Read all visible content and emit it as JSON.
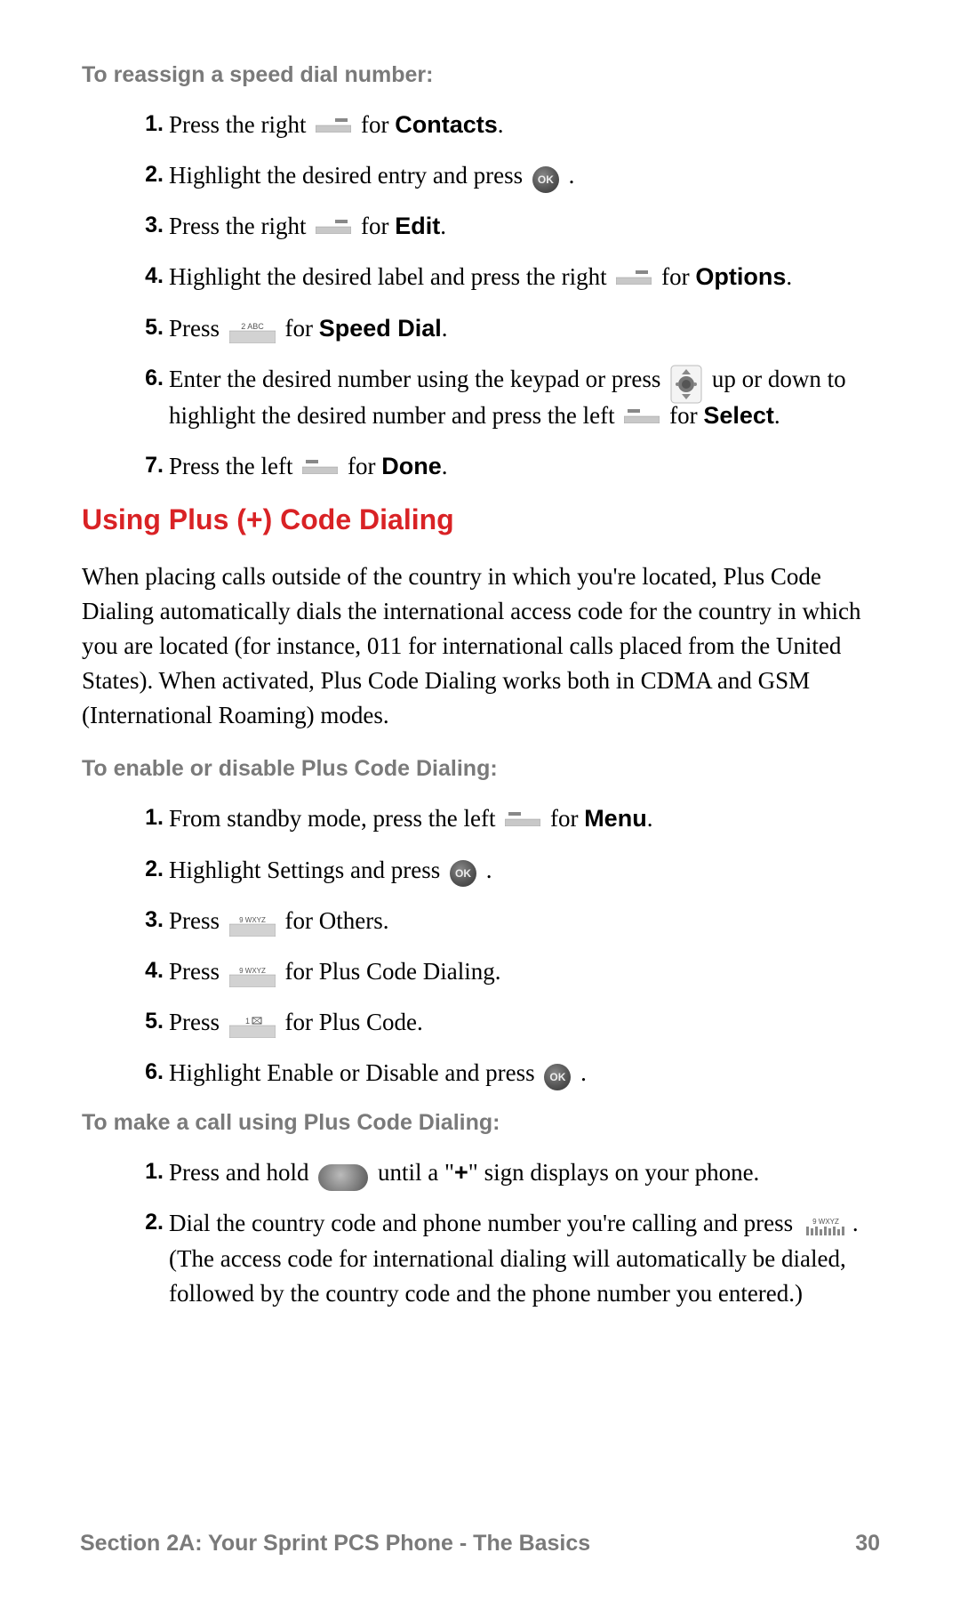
{
  "headings": {
    "reassign": "To reassign a speed dial number:",
    "section": "Using Plus (+) Code Dialing",
    "enable": "To enable or disable Plus Code Dialing:",
    "make_call": "To make a call using Plus Code Dialing:"
  },
  "steps_reassign": {
    "n1": "1.",
    "s1a": "Press the right ",
    "s1b": " for ",
    "s1c": "Contacts",
    "s1d": ".",
    "n2": "2.",
    "s2a": "Highlight the desired entry and press ",
    "s2b": ".",
    "n3": "3.",
    "s3a": " Press the right ",
    "s3b": " for ",
    "s3c": "Edit",
    "s3d": ".",
    "n4": "4.",
    "s4a": "Highlight the desired label and press the right ",
    "s4b": " for ",
    "s4c": "Options",
    "s4d": ".",
    "n5": "5.",
    "s5a": "Press ",
    "s5b": " for ",
    "s5c": "Speed Dial",
    "s5d": ".",
    "n6": "6.",
    "s6a": "Enter the desired number using the keypad or press ",
    "s6b": " up or down to highlight the desired number and press the left ",
    "s6c": " for ",
    "s6d": "Select",
    "s6e": ".",
    "n7": "7.",
    "s7a": "Press the left ",
    "s7b": " for ",
    "s7c": "Done",
    "s7d": "."
  },
  "para_plus": "When placing calls outside of the country in which you're located, Plus Code Dialing automatically dials the international access code for the country in which you are located (for instance, 011 for international calls placed from the United States). When activated, Plus Code Dialing works both in CDMA and GSM (International Roaming) modes.",
  "steps_enable": {
    "n1": "1.",
    "e1a": "From standby mode, press the left ",
    "e1b": " for ",
    "e1c": "Menu",
    "e1d": ".",
    "n2": "2.",
    "e2a": "Highlight Settings and press ",
    "e2b": ".",
    "n3": "3.",
    "e3a": "Press ",
    "e3b": " for Others.",
    "n4": "4.",
    "e4a": "Press ",
    "e4b": " for Plus Code Dialing.",
    "n5": "5.",
    "e5a": "Press ",
    "e5b": " for Plus Code.",
    "n6": "6.",
    "e6a": "Highlight Enable or Disable and press ",
    "e6b": "."
  },
  "steps_call": {
    "n1": "1.",
    "c1a": "Press and hold ",
    "c1b": " until a \"",
    "c1c": "+",
    "c1d": "\" sign displays on your phone.",
    "n2": "2.",
    "c2a": "Dial the country code and phone number you're calling and press ",
    "c2b": ". (The access code for international dialing will automatically be dialed, followed by the country code and the phone number you entered.)"
  },
  "key_labels": {
    "k2": "2 ABC",
    "k9": "9 WXYZ",
    "k1": "1",
    "ok": "OK"
  },
  "footer": {
    "section": "Section 2A: Your Sprint PCS Phone - The Basics",
    "page": "30"
  }
}
